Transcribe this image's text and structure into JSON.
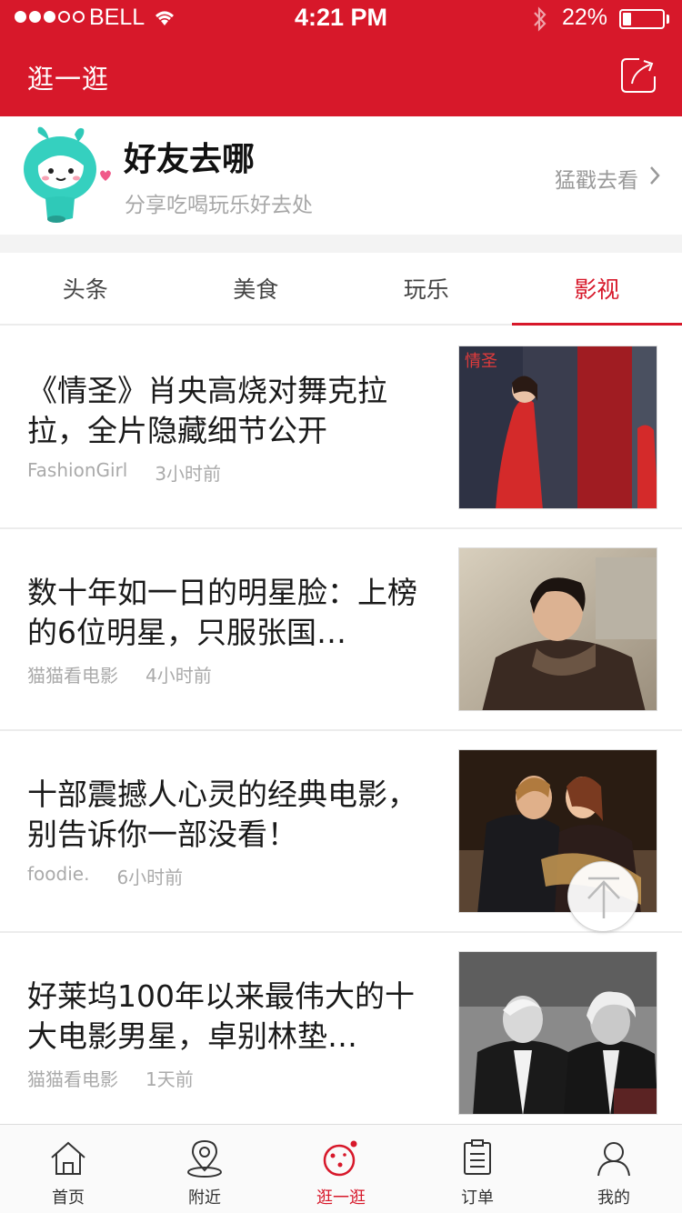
{
  "status_bar": {
    "carrier": "BELL",
    "time": "4:21 PM",
    "battery_percent": "22%",
    "battery_level": 0.22,
    "signal_bars": 3,
    "signal_total": 5
  },
  "nav": {
    "title": "逛一逛",
    "share_icon": "share-icon"
  },
  "banner": {
    "title": "好友去哪",
    "subtitle": "分享吃喝玩乐好去处",
    "link_label": "猛戳去看"
  },
  "tabs": [
    {
      "label": "头条",
      "active": false
    },
    {
      "label": "美食",
      "active": false
    },
    {
      "label": "玩乐",
      "active": false
    },
    {
      "label": "影视",
      "active": true
    }
  ],
  "articles": [
    {
      "title": "《情圣》肖央高烧对舞克拉拉，全片隐藏细节公开",
      "source": "FashionGirl",
      "time": "3小时前",
      "thumb_text": "情圣"
    },
    {
      "title": "数十年如一日的明星脸：上榜的6位明星，只服张国…",
      "source": "猫猫看电影",
      "time": "4小时前"
    },
    {
      "title": "十部震撼人心灵的经典电影，别告诉你一部没看！",
      "source": "foodie.",
      "time": "6小时前"
    },
    {
      "title": "好莱坞100年以来最伟大的十大电影男星，卓别林垫…",
      "source": "猫猫看电影",
      "time": "1天前"
    }
  ],
  "tabbar": [
    {
      "label": "首页",
      "icon": "home-icon",
      "active": false
    },
    {
      "label": "附近",
      "icon": "location-pin-icon",
      "active": false
    },
    {
      "label": "逛一逛",
      "icon": "planet-icon",
      "active": true
    },
    {
      "label": "订单",
      "icon": "order-list-icon",
      "active": false
    },
    {
      "label": "我的",
      "icon": "user-icon",
      "active": false
    }
  ],
  "colors": {
    "brand_red": "#d7182a",
    "muted_text": "#aaaaaa"
  }
}
